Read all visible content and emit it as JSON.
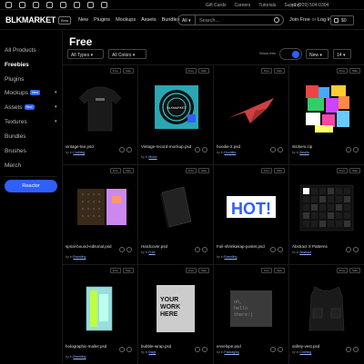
{
  "topbar": {
    "social_icons": [
      "facebook-icon",
      "instagram-icon",
      "twitter-icon",
      "pinterest-icon",
      "tiktok-icon",
      "discord-icon",
      "twitch-icon",
      "youtube-icon"
    ],
    "links": [
      "Gift Cards",
      "Careers",
      "Tutorials",
      "Support"
    ],
    "phone": "+1 (209) 504-0304"
  },
  "header": {
    "logo": "BLKMARKET",
    "logo_badge": "Beta",
    "nav": [
      "New",
      "Plugins",
      "Mockups",
      "Assets",
      "Bundles"
    ],
    "all_select": "All ▾",
    "search_placeholder": "Search...",
    "join": "Join Free",
    "or": "or",
    "login": "Log In",
    "cart_count": "$0"
  },
  "sidebar": {
    "items": [
      {
        "label": "All Products"
      },
      {
        "label": "Freebies",
        "active": true
      },
      {
        "label": "Plugins"
      },
      {
        "label": "Mockups",
        "pill": "New",
        "arrow": "▾"
      },
      {
        "label": "Assets",
        "pill": "New",
        "arrow": "▾"
      },
      {
        "label": "Textures",
        "arrow": "▾"
      },
      {
        "label": "Bundles"
      },
      {
        "label": "Brushes"
      },
      {
        "label": "Merch"
      }
    ],
    "button": "Reactor"
  },
  "main": {
    "title": "Free",
    "filters": {
      "types": "All Types ▾",
      "colors": "All Colors ▾",
      "show_info": "Show Info",
      "sort": "New ▾",
      "per_page": "14 ▾"
    },
    "card_badges": [
      "Free",
      "Sale"
    ],
    "cards": [
      {
        "name": "vintage-tee.psd",
        "by": "by",
        "in": "in",
        "category": "Clothing",
        "thumb": "tshirt"
      },
      {
        "name": "Vintage-record-mockup.psd",
        "by": "by",
        "in": "in",
        "category": "Music",
        "thumb": "record"
      },
      {
        "name": "hoodie-2.psd",
        "by": "by",
        "in": "in",
        "category": "Hoodies",
        "thumb": "plane"
      },
      {
        "name": "stickers.zip",
        "by": "by",
        "in": "in",
        "category": "Assets",
        "thumb": "stickers"
      },
      {
        "name": "spiral-bound-editorial.psd",
        "by": "by",
        "in": "in",
        "category": "Branding",
        "thumb": "book"
      },
      {
        "name": "Hardcover.psd",
        "by": "by",
        "in": "in",
        "category": "Free",
        "thumb": "hardcover"
      },
      {
        "name": "Foil-shrinkwrap-poster.psd",
        "by": "by",
        "in": "in",
        "category": "Branding",
        "thumb": "hot"
      },
      {
        "name": "Abstract X Patterns",
        "by": "by",
        "in": "in",
        "category": "Abstract",
        "thumb": "patterns"
      },
      {
        "name": "holographic-mailer.psd",
        "by": "by",
        "in": "in",
        "category": "Branding",
        "thumb": "mailer"
      },
      {
        "name": "bubble-wrap.psd",
        "by": "by",
        "in": "in",
        "category": "Bags",
        "thumb": "bubble"
      },
      {
        "name": "envelope.psd",
        "by": "by",
        "in": "in",
        "category": "Packaging",
        "thumb": "envelope"
      },
      {
        "name": "safety-vest.psd",
        "by": "by",
        "in": "in",
        "category": "Clothing",
        "thumb": "vest"
      }
    ],
    "thumb_text": {
      "record_label": "BLKMARKET",
      "hot": "HOT!",
      "bubble": "YOUR\nWORK\nHERE",
      "envelope": "oh,\nhello\nthere:)"
    }
  },
  "colors": {
    "accent": "#2f5fff",
    "background": "#000000",
    "link": "#8fb4ff"
  }
}
